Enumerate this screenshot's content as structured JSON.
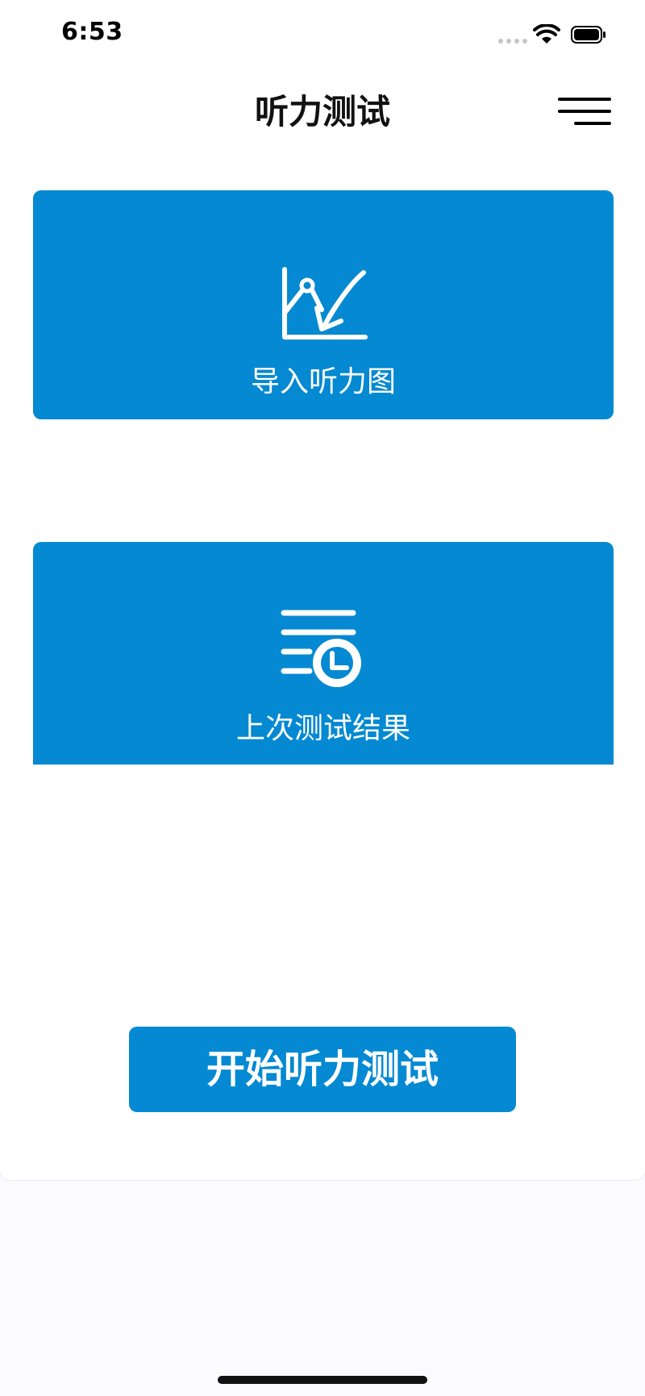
{
  "status_bar": {
    "time": "6:53"
  },
  "nav": {
    "title": "听力测试",
    "menu_icon": "hamburger-menu-icon"
  },
  "cards": [
    {
      "label": "导入听力图",
      "icon": "chart-import-icon"
    },
    {
      "label": "上次测试结果",
      "icon": "history-clock-icon"
    }
  ],
  "start_button": {
    "label": "开始听力测试"
  },
  "colors": {
    "accent": "#0489d2",
    "background": "#ffffff",
    "text": "#111111"
  }
}
